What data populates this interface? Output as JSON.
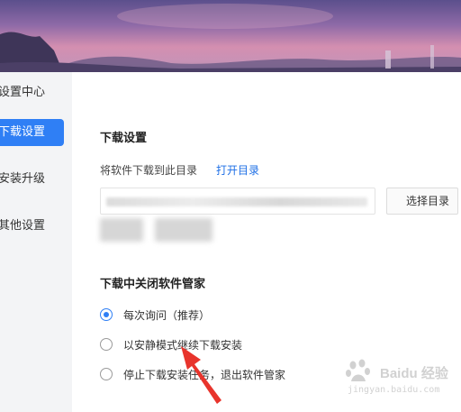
{
  "sidebar": {
    "items": [
      {
        "label": "设置中心",
        "active": false
      },
      {
        "label": "下载设置",
        "active": true
      },
      {
        "label": "安装升级",
        "active": false
      },
      {
        "label": "其他设置",
        "active": false
      }
    ]
  },
  "download": {
    "section_title": "下载设置",
    "desc": "将软件下载到此目录",
    "open_link": "打开目录",
    "choose_button": "选择目录"
  },
  "close_on_download": {
    "section_title": "下载中关闭软件管家",
    "options": [
      {
        "label": "每次询问（推荐）",
        "checked": true
      },
      {
        "label": "以安静模式继续下载安装",
        "checked": false
      },
      {
        "label": "停止下载安装任务，退出软件管家",
        "checked": false
      }
    ]
  },
  "colors": {
    "accent": "#2f7ff5",
    "link": "#1e6fe6",
    "arrow": "#e8342c"
  },
  "watermark": {
    "text": "Baidu 经验",
    "sub": "jingyan.baidu.com"
  }
}
